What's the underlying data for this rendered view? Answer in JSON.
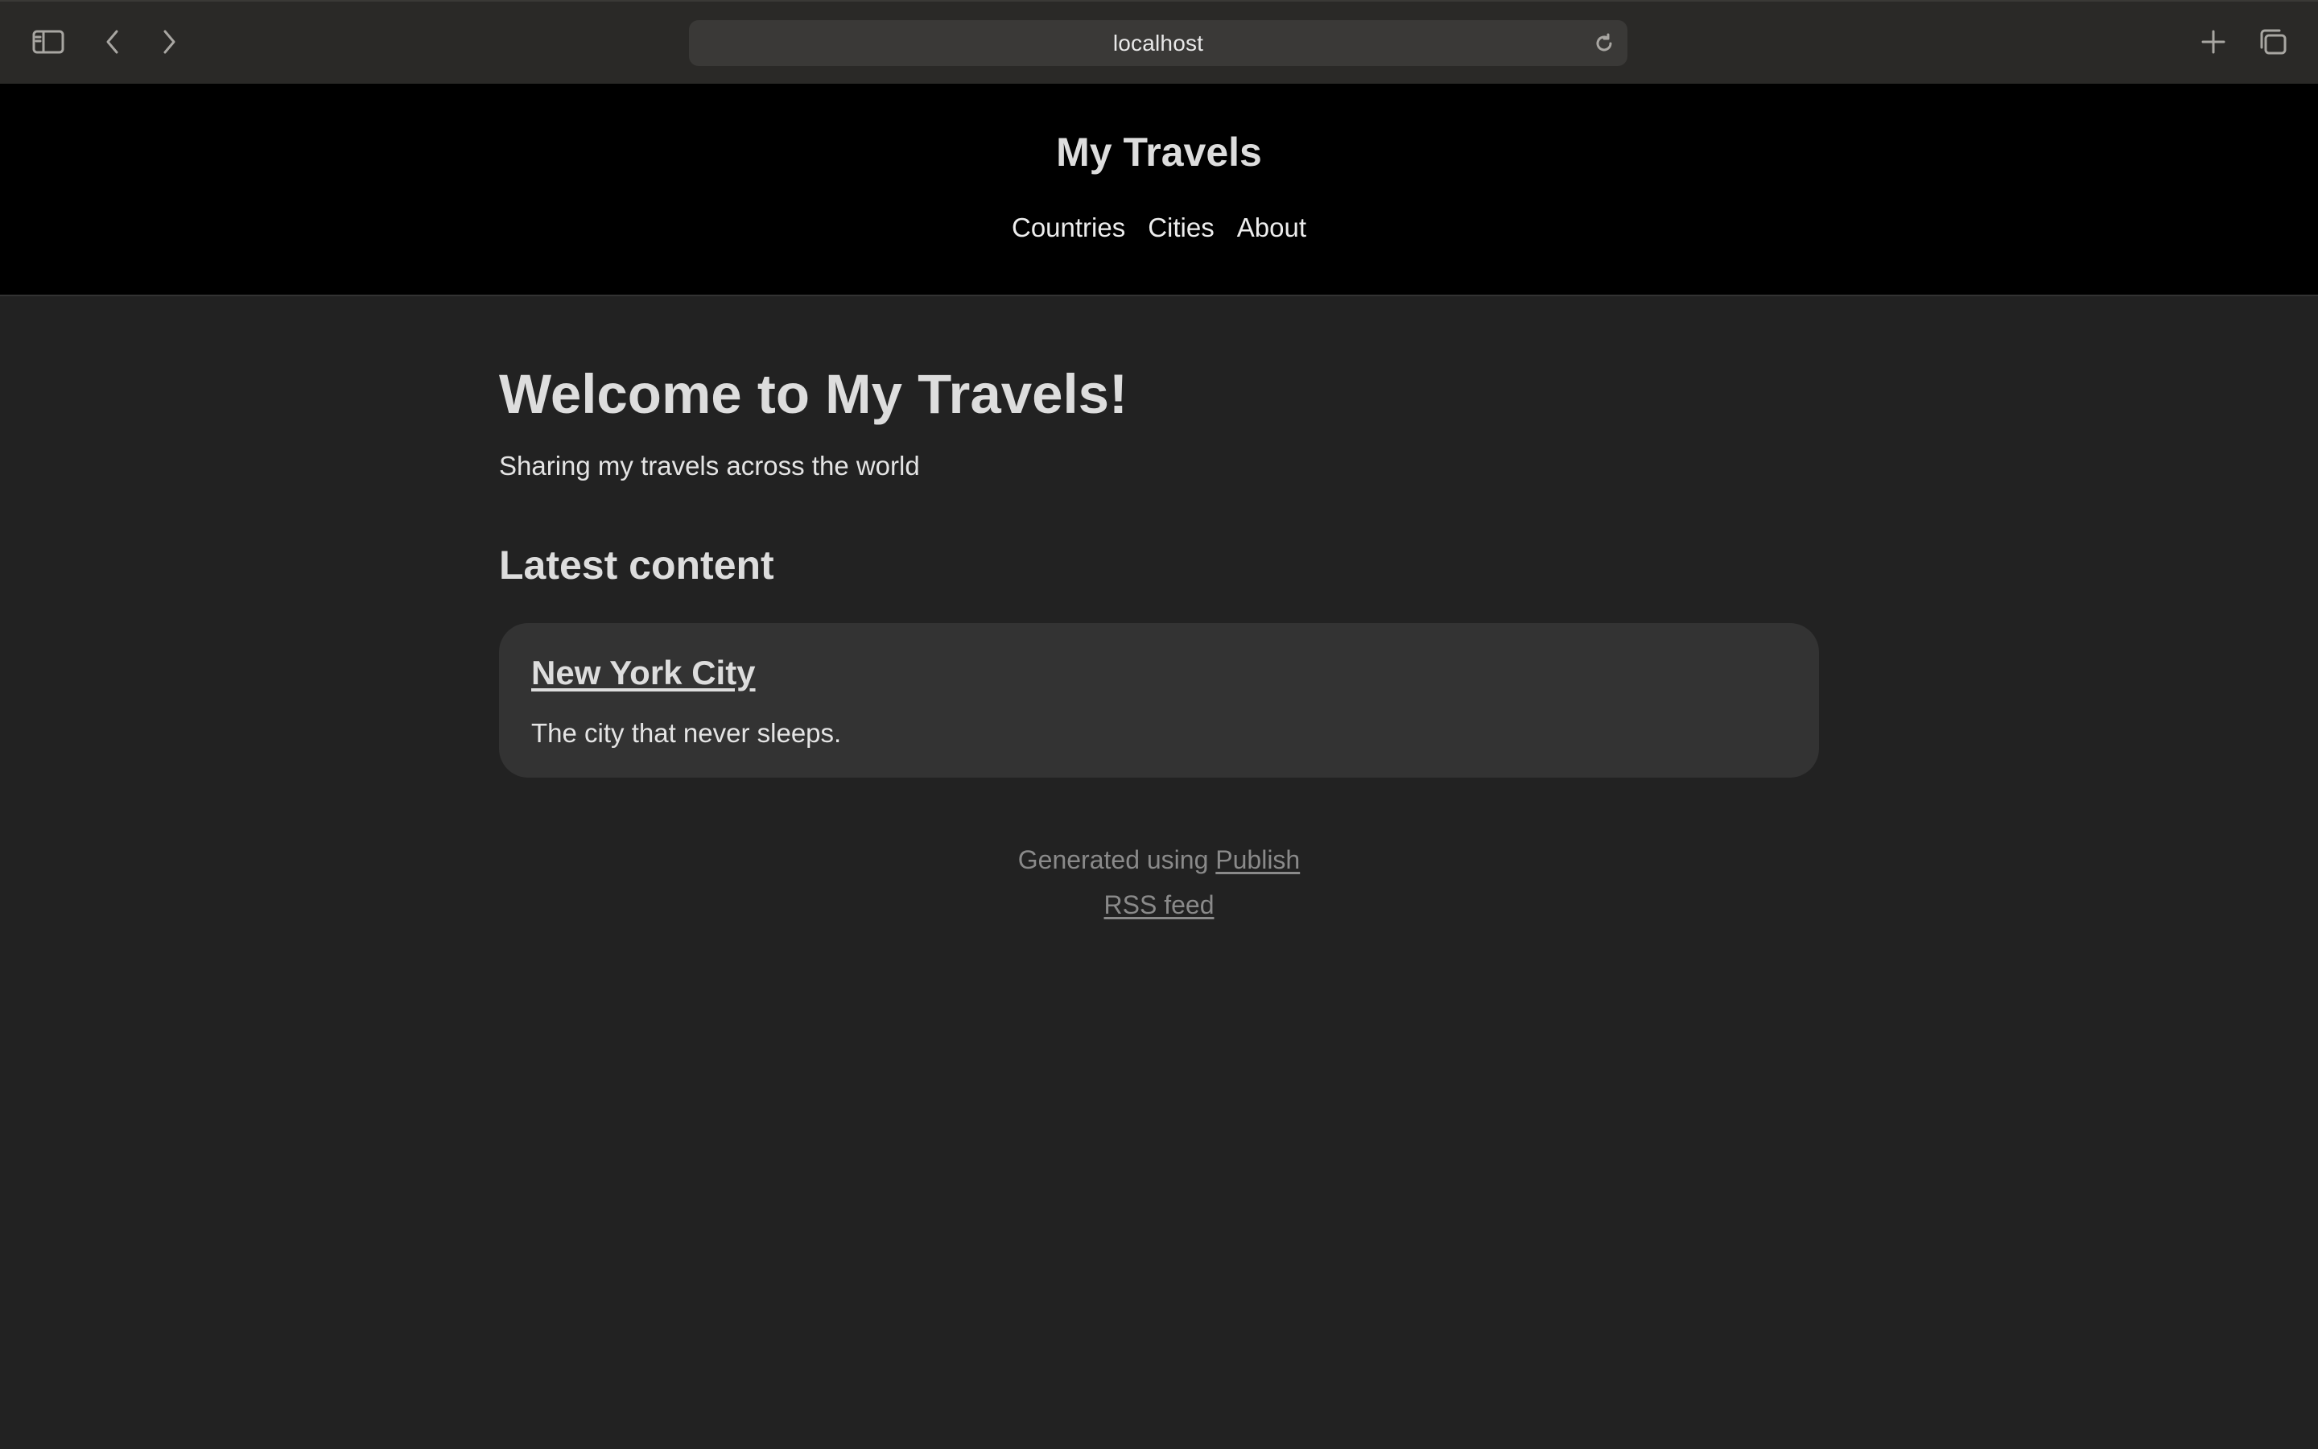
{
  "browser": {
    "url": "localhost",
    "icons": {
      "sidebar": "sidebar-icon",
      "back": "chevron-left-icon",
      "forward": "chevron-right-icon",
      "reload": "reload-icon",
      "new_tab": "plus-icon",
      "tabs": "tab-overview-icon"
    }
  },
  "header": {
    "site_title": "My Travels",
    "nav": [
      {
        "label": "Countries"
      },
      {
        "label": "Cities"
      },
      {
        "label": "About"
      }
    ]
  },
  "main": {
    "heading": "Welcome to My Travels!",
    "tagline": "Sharing my travels across the world",
    "latest_heading": "Latest content",
    "items": [
      {
        "title": "New York City",
        "description": "The city that never sleeps."
      }
    ]
  },
  "footer": {
    "generated_prefix": "Generated using ",
    "generated_link": "Publish",
    "rss_link": "RSS feed"
  },
  "colors": {
    "page_bg": "#222222",
    "header_bg": "#000000",
    "card_bg": "#333333",
    "text": "#dddddd",
    "muted": "#8a8a8a"
  }
}
